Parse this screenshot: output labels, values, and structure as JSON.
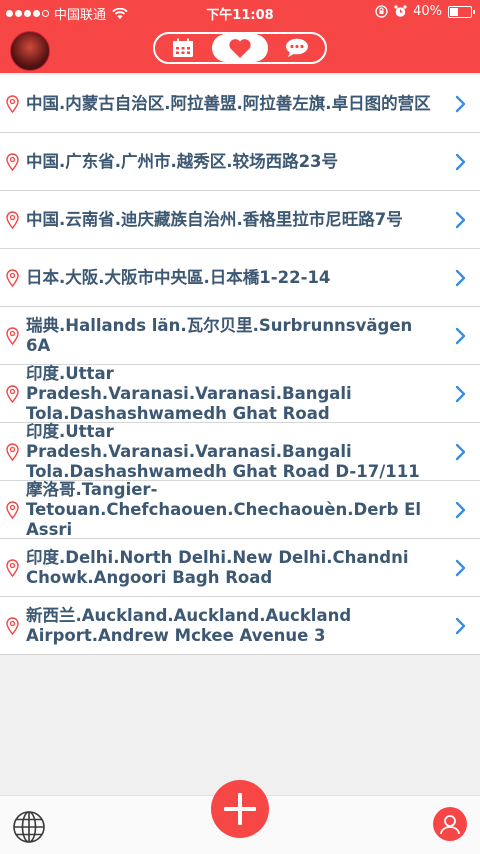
{
  "status_bar": {
    "carrier": "中国联通",
    "time": "下午11:08",
    "battery": "40%",
    "battery_level": 0.4
  },
  "header": {
    "tabs": [
      {
        "icon": "calendar-icon",
        "active": false
      },
      {
        "icon": "heart-icon",
        "active": true
      },
      {
        "icon": "chat-bubble-icon",
        "active": false
      }
    ]
  },
  "locations": [
    "中国.内蒙古自治区.阿拉善盟.阿拉善左旗.卓日图的营区",
    "中国.广东省.广州市.越秀区.较场西路23号",
    "中国.云南省.迪庆藏族自治州.香格里拉市尼旺路7号",
    "日本.大阪.大阪市中央區.日本橋1-22-14",
    "瑞典.Hallands län.瓦尔贝里.Surbrunnsvägen 6A",
    "印度.Uttar Pradesh.Varanasi.Varanasi.Bangali Tola.Dashashwamedh Ghat Road",
    "印度.Uttar Pradesh.Varanasi.Varanasi.Bangali Tola.Dashashwamedh Ghat Road D-17/111",
    "摩洛哥.Tangier-Tetouan.Chefchaouen.Chechaouèn.Derb El Assri",
    "印度.Delhi.North Delhi.New Delhi.Chandni Chowk.Angoori Bagh Road",
    "新西兰.Auckland.Auckland.Auckland Airport.Andrew Mckee Avenue 3"
  ],
  "colors": {
    "accent": "#f64646",
    "text": "#3d5873",
    "chevron": "#3a8fe0"
  }
}
